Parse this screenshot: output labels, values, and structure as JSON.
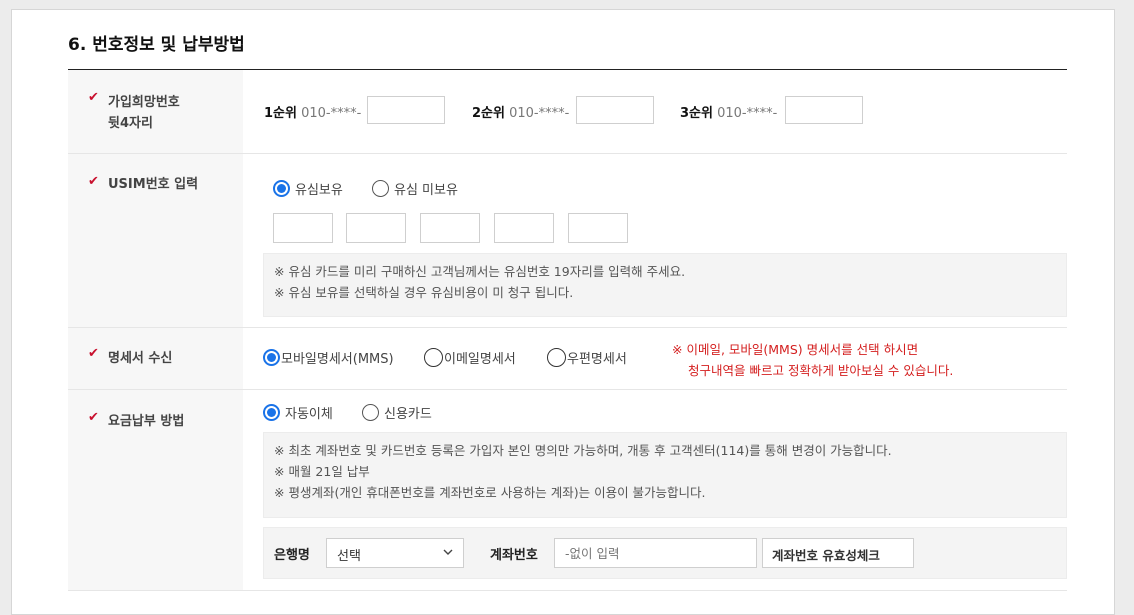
{
  "section": {
    "title": "6. 번호정보 및 납부방법"
  },
  "check_mark": "✔",
  "hope_number": {
    "label_line1": "가입희망번호",
    "label_line2": "뒷4자리",
    "ranks": [
      {
        "rank": "1순위",
        "prefix": "010-****-",
        "value": ""
      },
      {
        "rank": "2순위",
        "prefix": "010-****-",
        "value": ""
      },
      {
        "rank": "3순위",
        "prefix": "010-****-",
        "value": ""
      }
    ]
  },
  "usim": {
    "label": "USIM번호 입력",
    "options": [
      {
        "label": "유심보유",
        "selected": true
      },
      {
        "label": "유심 미보유",
        "selected": false
      }
    ],
    "notice": [
      "※ 유심 카드를 미리 구매하신 고객님께서는 유심번호 19자리를 입력해 주세요.",
      "※ 유심 보유를 선택하실 경우 유심비용이 미 청구 됩니다."
    ]
  },
  "statement": {
    "label": "명세서 수신",
    "options": [
      {
        "label": "모바일명세서(MMS)",
        "selected": true
      },
      {
        "label": "이메일명세서",
        "selected": false
      },
      {
        "label": "우편명세서",
        "selected": false
      }
    ],
    "note_line1": "※ 이메일, 모바일(MMS) 명세서를 선택 하시면",
    "note_line2": "청구내역을 빠르고 정확하게 받아보실 수 있습니다."
  },
  "payment": {
    "label": "요금납부 방법",
    "options": [
      {
        "label": "자동이체",
        "selected": true
      },
      {
        "label": "신용카드",
        "selected": false
      }
    ],
    "notice": [
      "※ 최초 계좌번호 및 카드번호 등록은 가입자 본인 명의만 가능하며, 개통 후 고객센터(114)를 통해 변경이 가능합니다.",
      "※ 매월 21일 납부",
      "※ 평생계좌(개인 휴대폰번호를 계좌번호로 사용하는 계좌)는 이용이 불가능합니다."
    ],
    "bank_label": "은행명",
    "bank_selected": "선택",
    "account_label": "계좌번호",
    "account_placeholder": "-없이 입력",
    "account_check_button": "계좌번호 유효성체크"
  },
  "colors": {
    "accent": "#1a73e8",
    "check": "#c8102e",
    "notice_red": "#d41f1f"
  }
}
